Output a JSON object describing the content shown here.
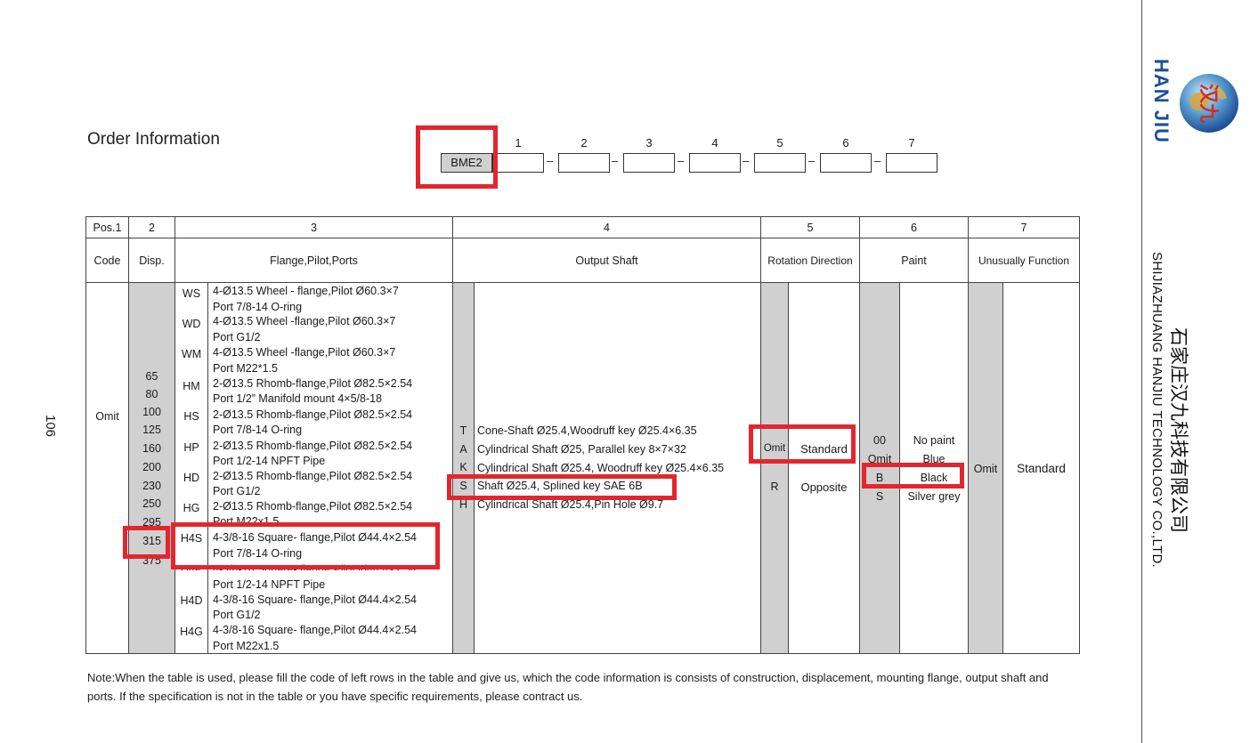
{
  "page_number": "106",
  "title": "Order Information",
  "order_code": {
    "prefix": "BME2",
    "positions": [
      "1",
      "2",
      "3",
      "4",
      "5",
      "6",
      "7"
    ]
  },
  "header_row1": [
    "Pos.1",
    "2",
    "3",
    "4",
    "5",
    "6",
    "7"
  ],
  "header_row2": [
    "Code",
    "Disp.",
    "Flange,Pilot,Ports",
    "Output Shaft",
    "Rotation Direction",
    "Paint",
    "Unusually Function"
  ],
  "code_col": "Omit",
  "displacements": [
    "65",
    "80",
    "100",
    "125",
    "160",
    "200",
    "230",
    "250",
    "295",
    "315",
    "375"
  ],
  "flanges": [
    {
      "code": "WS",
      "line1": "4-Ø13.5 Wheel - flange,Pilot Ø60.3×7",
      "line2": "Port  7/8-14 O-ring"
    },
    {
      "code": "WD",
      "line1": "4-Ø13.5 Wheel -flange,Pilot Ø60.3×7",
      "line2": "Port G1/2"
    },
    {
      "code": "WM",
      "line1": "4-Ø13.5 Wheel -flange,Pilot Ø60.3×7",
      "line2": "Port M22*1.5"
    },
    {
      "code": "HM",
      "line1": "2-Ø13.5 Rhomb-flange,Pilot Ø82.5×2.54",
      "line2": "Port  1/2” Manifold mount 4×5/8-18"
    },
    {
      "code": "HS",
      "line1": "2-Ø13.5 Rhomb-flange,Pilot Ø82.5×2.54",
      "line2": "Port  7/8-14 O-ring"
    },
    {
      "code": "HP",
      "line1": "2-Ø13.5 Rhomb-flange,Pilot Ø82.5×2.54",
      "line2": "Port  1/2-14 NPFT Pipe"
    },
    {
      "code": "HD",
      "line1": "2-Ø13.5 Rhomb-flange,Pilot Ø82.5×2.54",
      "line2": "Port  G1/2"
    },
    {
      "code": "HG",
      "line1": "2-Ø13.5 Rhomb-flange,Pilot Ø82.5×2.54",
      "line2": "Port  M22x1.5"
    },
    {
      "code": "H4S",
      "line1": "4-3/8-16 Square- flange,Pilot Ø44.4×2.54",
      "line2": "Port  7/8-14 O-ring"
    },
    {
      "code": "H4P",
      "line1": "4-3/8-16 Square- flange,Pilot Ø44.4×2.54",
      "line2": "Port  1/2-14 NPFT Pipe"
    },
    {
      "code": "H4D",
      "line1": "4-3/8-16 Square- flange,Pilot Ø44.4×2.54",
      "line2": "Port  G1/2"
    },
    {
      "code": "H4G",
      "line1": "4-3/8-16 Square- flange,Pilot Ø44.4×2.54",
      "line2": "Port  M22x1.5"
    }
  ],
  "shafts": [
    {
      "code": "T",
      "desc": "Cone-Shaft Ø25.4,Woodruff key Ø25.4×6.35"
    },
    {
      "code": "A",
      "desc": "Cylindrical Shaft Ø25, Parallel key 8×7×32"
    },
    {
      "code": "K",
      "desc": "Cylindrical Shaft Ø25.4, Woodruff key Ø25.4×6.35"
    },
    {
      "code": "S",
      "desc": "Shaft Ø25.4, Splined key SAE 6B"
    },
    {
      "code": "H",
      "desc": "Cylindrical Shaft Ø25.4,Pin Hole Ø9.7"
    }
  ],
  "rotation": [
    {
      "code": "Omit",
      "desc": "Standard"
    },
    {
      "code": "R",
      "desc": "Opposite"
    }
  ],
  "paint": [
    {
      "code": "00",
      "desc": "No paint"
    },
    {
      "code": "Omit",
      "desc": "Blue"
    },
    {
      "code": "B",
      "desc": "Black"
    },
    {
      "code": "S",
      "desc": "Silver grey"
    }
  ],
  "unusual": {
    "code": "Omit",
    "desc": "Standard"
  },
  "note": "Note:When the table is used, please fill the code of left rows in the table and give us, which the code information is consists of construction, displacement, mounting flange, output shaft and ports. If the specification is not in the table or you have specific requirements, please contract us.",
  "brand": {
    "name": "HAN JIU",
    "cn": "石家庄汉九科技有限公司",
    "en": "SHIJIAZHUANG HANJIU TECHNOLOGY CO.,LTD."
  },
  "colors": {
    "highlight": "#e3262d",
    "shade": "#d0d0d0",
    "brand_blue": "#1f4f95"
  }
}
